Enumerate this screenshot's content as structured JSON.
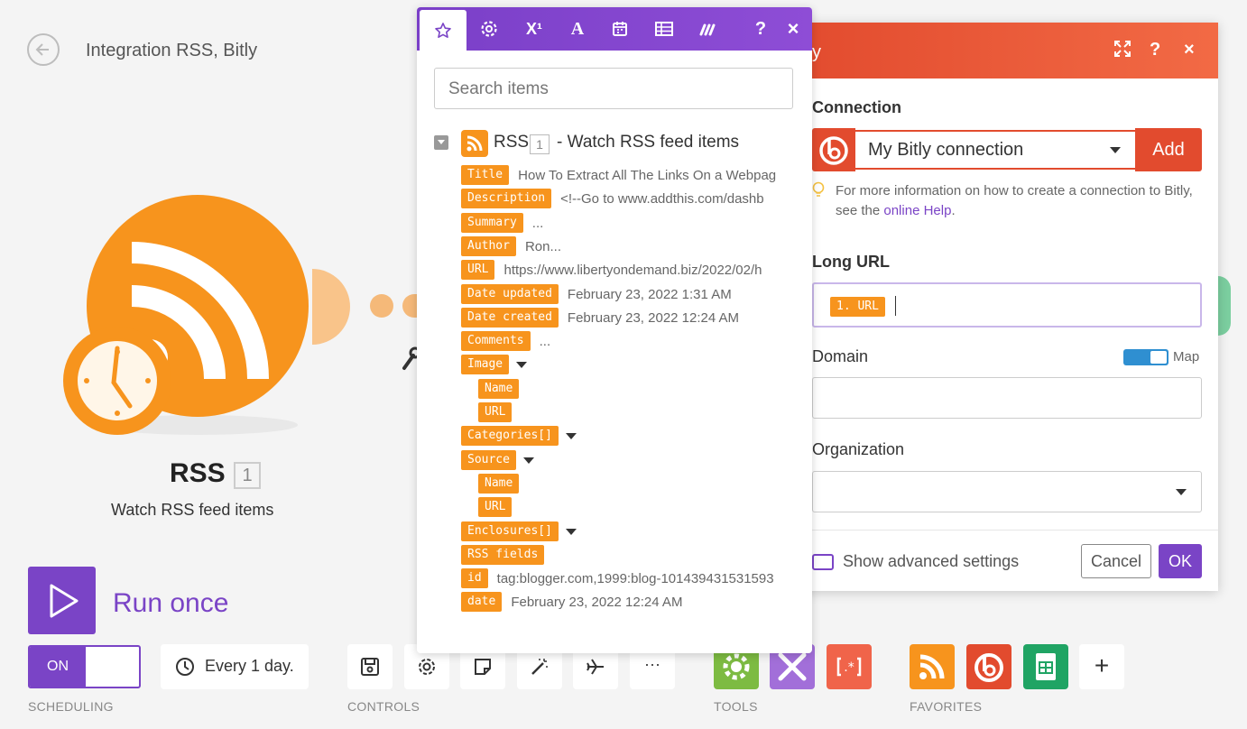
{
  "header": {
    "title": "Integration RSS, Bitly"
  },
  "module": {
    "name": "RSS",
    "number": "1",
    "subtitle": "Watch RSS feed items"
  },
  "run": {
    "label": "Run once"
  },
  "toolbar": {
    "scheduling_state": "ON",
    "schedule_text": "Every 1 day.",
    "sections": {
      "scheduling": "SCHEDULING",
      "controls": "CONTROLS",
      "tools": "TOOLS",
      "favorites": "FAVORITES"
    },
    "more_label": "···",
    "add_label": "+"
  },
  "mapping": {
    "tabs": [
      "star-icon",
      "gear-icon",
      "superscript-icon",
      "text-icon",
      "calendar-icon",
      "table-icon",
      "make-icon",
      "help-icon",
      "close-icon"
    ],
    "help_label": "?",
    "close_label": "×",
    "search_placeholder": "Search items",
    "source": {
      "app": "RSS",
      "number": "1",
      "description": "- Watch RSS feed items"
    },
    "items": [
      {
        "label": "Title",
        "value": "How To Extract All The Links On a Webpag",
        "indent": 0
      },
      {
        "label": "Description",
        "value": "<!--Go to www.addthis.com/dashb",
        "indent": 0
      },
      {
        "label": "Summary",
        "value": "...",
        "indent": 0
      },
      {
        "label": "Author",
        "value": "Ron...",
        "indent": 0
      },
      {
        "label": "URL",
        "value": "https://www.libertyondemand.biz/2022/02/h",
        "indent": 0
      },
      {
        "label": "Date updated",
        "value": "February 23, 2022 1:31 AM",
        "indent": 0
      },
      {
        "label": "Date created",
        "value": "February 23, 2022 12:24 AM",
        "indent": 0
      },
      {
        "label": "Comments",
        "value": "...",
        "indent": 0
      },
      {
        "label": "Image",
        "value": "",
        "indent": 0,
        "expandable": true
      },
      {
        "label": "Name",
        "value": "",
        "indent": 1
      },
      {
        "label": "URL",
        "value": "",
        "indent": 1
      },
      {
        "label": "Categories[]",
        "value": "",
        "indent": 0,
        "expandable": true
      },
      {
        "label": "Source",
        "value": "",
        "indent": 0,
        "expandable": true
      },
      {
        "label": "Name",
        "value": "",
        "indent": 1
      },
      {
        "label": "URL",
        "value": "",
        "indent": 1
      },
      {
        "label": "Enclosures[]",
        "value": "",
        "indent": 0,
        "expandable": true
      },
      {
        "label": "RSS fields",
        "value": "",
        "indent": 0
      },
      {
        "label": "id",
        "value": "tag:blogger.com,1999:blog-101439431531593",
        "indent": 0
      },
      {
        "label": "date",
        "value": "February 23, 2022 12:24 AM",
        "indent": 0
      }
    ]
  },
  "bitly": {
    "header_partial": "y",
    "help_label": "?",
    "close_label": "×",
    "connection": {
      "label": "Connection",
      "value": "My Bitly connection",
      "add_label": "Add",
      "hint_prefix": "For more information on how to create a connection to Bitly, see the ",
      "hint_link": "online Help",
      "hint_suffix": "."
    },
    "long_url": {
      "label": "Long URL",
      "mapped_value": "1. URL"
    },
    "domain": {
      "label": "Domain",
      "map_label": "Map",
      "value": ""
    },
    "organization": {
      "label": "Organization",
      "value": ""
    },
    "advanced_label": "Show advanced settings",
    "cancel_label": "Cancel",
    "ok_label": "OK"
  },
  "colors": {
    "accent": "#7a44c6",
    "rss": "#f7941d",
    "bitly": "#e24b2e"
  }
}
